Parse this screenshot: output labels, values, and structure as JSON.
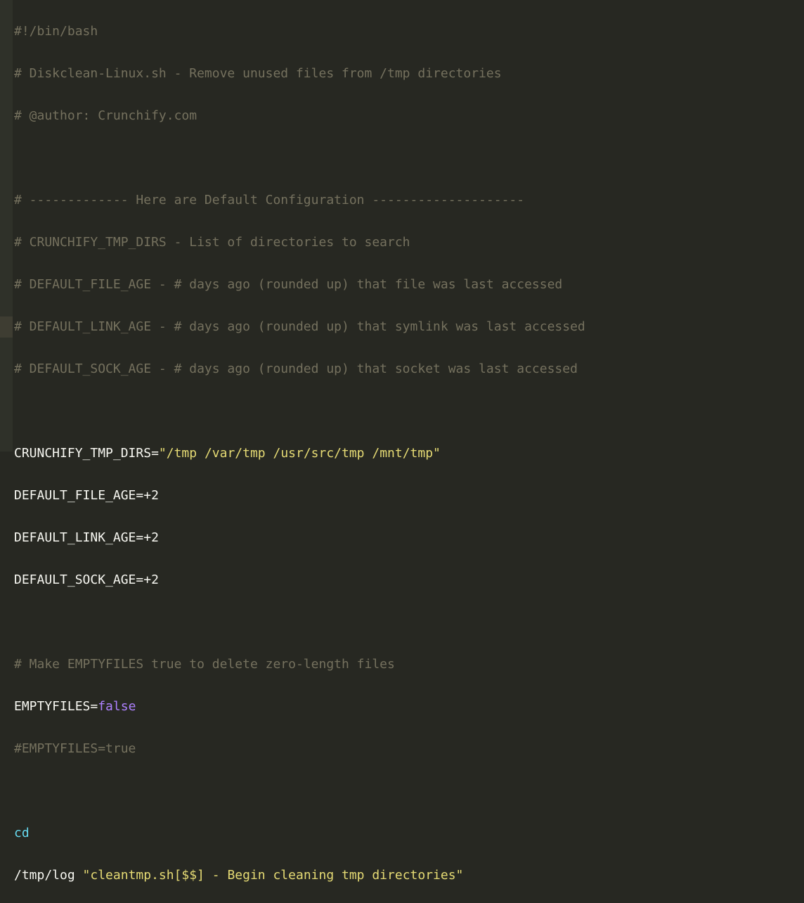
{
  "lines": {
    "l1_shebang": "#!/bin/bash",
    "l2_comment": "# Diskclean-Linux.sh - Remove unused files from /tmp directories",
    "l3_comment": "# @author: Crunchify.com",
    "l4_blank": "",
    "l5_comment": "# ------------- Here are Default Configuration --------------------",
    "l6_comment": "# CRUNCHIFY_TMP_DIRS - List of directories to search",
    "l7_comment": "# DEFAULT_FILE_AGE - # days ago (rounded up) that file was last accessed",
    "l8_comment": "# DEFAULT_LINK_AGE - # days ago (rounded up) that symlink was last accessed",
    "l9_comment": "# DEFAULT_SOCK_AGE - # days ago (rounded up) that socket was last accessed",
    "l10_blank": "",
    "l11_var": "CRUNCHIFY_TMP_DIRS",
    "l11_eq": "=",
    "l11_str": "\"/tmp /var/tmp /usr/src/tmp /mnt/tmp\"",
    "l12_var": "DEFAULT_FILE_AGE",
    "l12_rest": "=+2",
    "l13_var": "DEFAULT_LINK_AGE",
    "l13_rest": "=+2",
    "l14_var": "DEFAULT_SOCK_AGE",
    "l14_rest": "=+2",
    "l15_blank": "",
    "l16_comment": "# Make EMPTYFILES true to delete zero-length files",
    "l17_var": "EMPTYFILES",
    "l17_eq": "=",
    "l17_val": "false",
    "l18_comment": "#EMPTYFILES=true",
    "l19_blank": "",
    "l20_cd": "cd",
    "l21_path": "/tmp/log ",
    "l21_str": "\"cleantmp.sh[$$] - Begin cleaning tmp directories\""
  }
}
